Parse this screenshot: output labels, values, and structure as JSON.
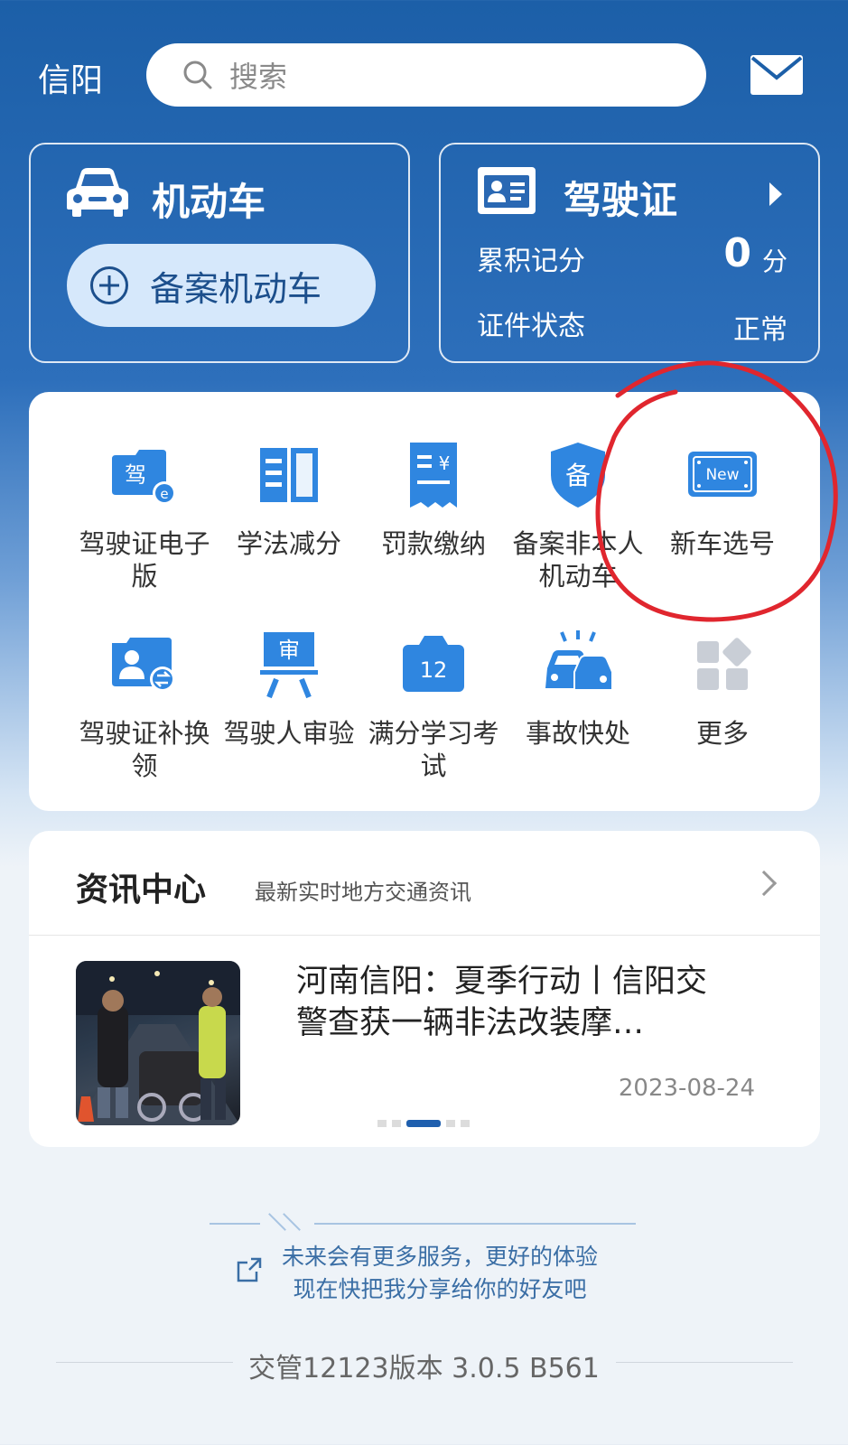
{
  "header": {
    "city": "信阳",
    "search_placeholder": "搜索"
  },
  "vehicle_card": {
    "title": "机动车",
    "add_button_label": "备案机动车"
  },
  "license_card": {
    "title": "驾驶证",
    "score_label": "累积记分",
    "score_value": "0",
    "score_unit": "分",
    "status_label": "证件状态",
    "status_value": "正常"
  },
  "services": [
    {
      "label": "驾驶证电子版",
      "icon": "e-license-icon"
    },
    {
      "label": "学法减分",
      "icon": "book-icon"
    },
    {
      "label": "罚款缴纳",
      "icon": "receipt-icon"
    },
    {
      "label": "备案非本人机动车",
      "icon": "shield-icon"
    },
    {
      "label": "新车选号",
      "icon": "new-plate-icon"
    },
    {
      "label": "驾驶证补换领",
      "icon": "license-renew-icon"
    },
    {
      "label": "驾驶人审验",
      "icon": "review-icon"
    },
    {
      "label": "满分学习考试",
      "icon": "calendar-12-icon"
    },
    {
      "label": "事故快处",
      "icon": "accident-icon"
    },
    {
      "label": "更多",
      "icon": "more-grid-icon"
    }
  ],
  "news": {
    "title": "资讯中心",
    "subtitle": "最新实时地方交通资讯",
    "headline": "河南信阳：夏季行动丨信阳交警查获一辆非法改装摩…",
    "date": "2023-08-24"
  },
  "footer": {
    "share_line1": "未来会有更多服务，更好的体验",
    "share_line2": "现在快把我分享给你的好友吧",
    "version": "交管12123版本 3.0.5 B561"
  },
  "colors": {
    "primary": "#1f5fae",
    "accent_light": "#d6e8fb",
    "annotation": "#e0262e"
  }
}
